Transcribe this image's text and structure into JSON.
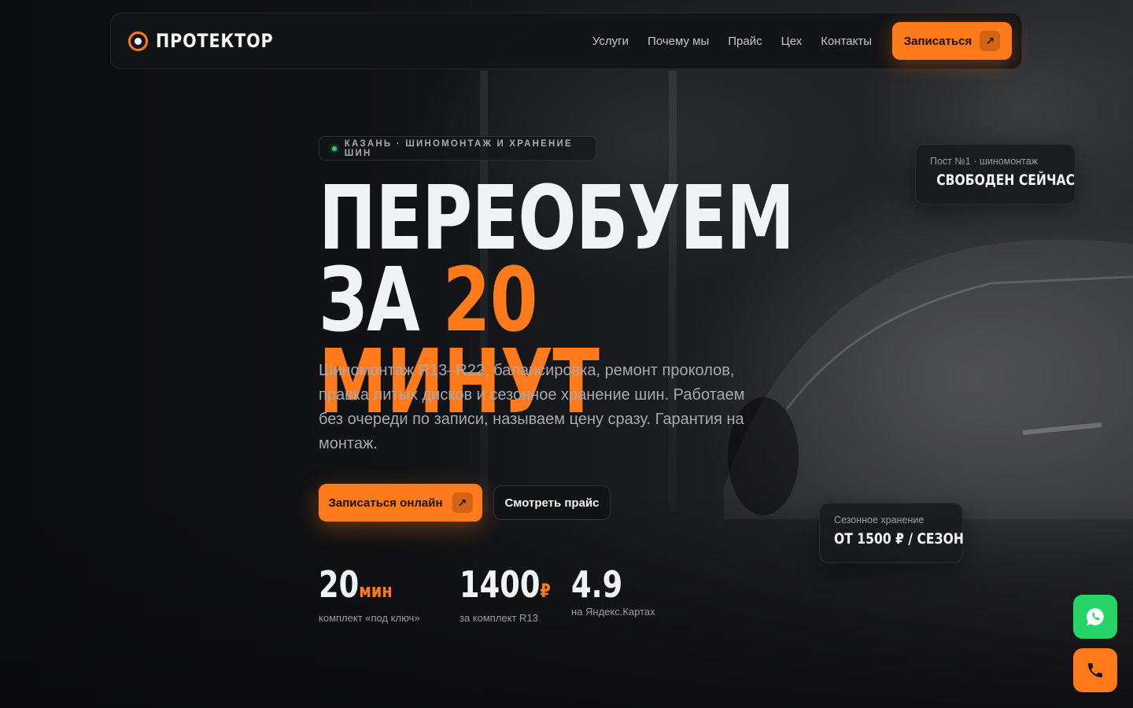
{
  "brand": {
    "name": "ПРОТЕКТОР"
  },
  "nav": {
    "links": [
      "Услуги",
      "Почему мы",
      "Прайс",
      "Цех",
      "Контакты"
    ],
    "cta_label": "Записаться"
  },
  "hero": {
    "badge": "КАЗАНЬ · ШИНОМОНТАЖ И ХРАНЕНИЕ ШИН",
    "headline_line1": "ПЕРЕОБУЕМ",
    "headline_line2_prefix": "ЗА",
    "headline_line2_accent": "20 МИНУТ",
    "lead": "Шиномонтаж R13–R22, балансировка, ремонт проколов, правка литых дисков и сезонное хранение шин. Работаем без очереди по записи, называем цену сразу. Гарантия на монтаж.",
    "primary_button": "Записаться онлайн",
    "secondary_button": "Смотреть прайс"
  },
  "stats": [
    {
      "value": "20",
      "unit": "мин",
      "label": "комплект «под ключ»"
    },
    {
      "value": "1400",
      "unit": "₽",
      "label": "за комплект R13"
    },
    {
      "value": "4.9",
      "unit": "",
      "label": "на Яндекс.Картах"
    }
  ],
  "cards": {
    "post": {
      "label": "Пост №1 · шиномонтаж",
      "value": "СВОБОДЕН СЕЙЧАС"
    },
    "storage": {
      "label": "Сезонное хранение",
      "value": "ОТ 1500 ₽ / СЕЗОН"
    }
  },
  "icons": {
    "whatsapp": "whatsapp-icon",
    "phone": "phone-icon",
    "arrow": "↗"
  },
  "colors": {
    "accent": "#ff7a1a",
    "whatsapp": "#25d366",
    "status": "#2ecc71",
    "background": "#0d0e10"
  }
}
